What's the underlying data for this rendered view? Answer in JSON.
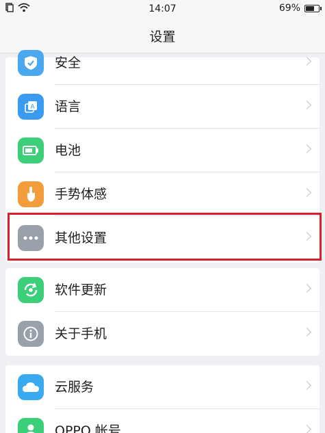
{
  "status_bar": {
    "time": "14:07",
    "battery_percent": "69%",
    "battery_level": 0.69
  },
  "header": {
    "title": "设置"
  },
  "settings_items": [
    {
      "label": "安全",
      "icon": "shield-icon",
      "color": "#4aa8f0"
    },
    {
      "label": "语言",
      "icon": "language-icon",
      "color": "#3a9bf0"
    },
    {
      "label": "电池",
      "icon": "battery-icon",
      "color": "#3ccf7a"
    },
    {
      "label": "手势体感",
      "icon": "gesture-icon",
      "color": "#f39c3c"
    },
    {
      "label": "其他设置",
      "icon": "more-icon",
      "color": "#9aa0aa"
    },
    {
      "label": "软件更新",
      "icon": "update-icon",
      "color": "#3ccf7a"
    },
    {
      "label": "关于手机",
      "icon": "info-icon",
      "color": "#9aa0aa"
    },
    {
      "label": "云服务",
      "icon": "cloud-icon",
      "color": "#3aaaf0"
    },
    {
      "label": "OPPO 帐号",
      "icon": "account-icon",
      "color": "#3ccf7a"
    }
  ],
  "highlight_color": "#d8202a"
}
